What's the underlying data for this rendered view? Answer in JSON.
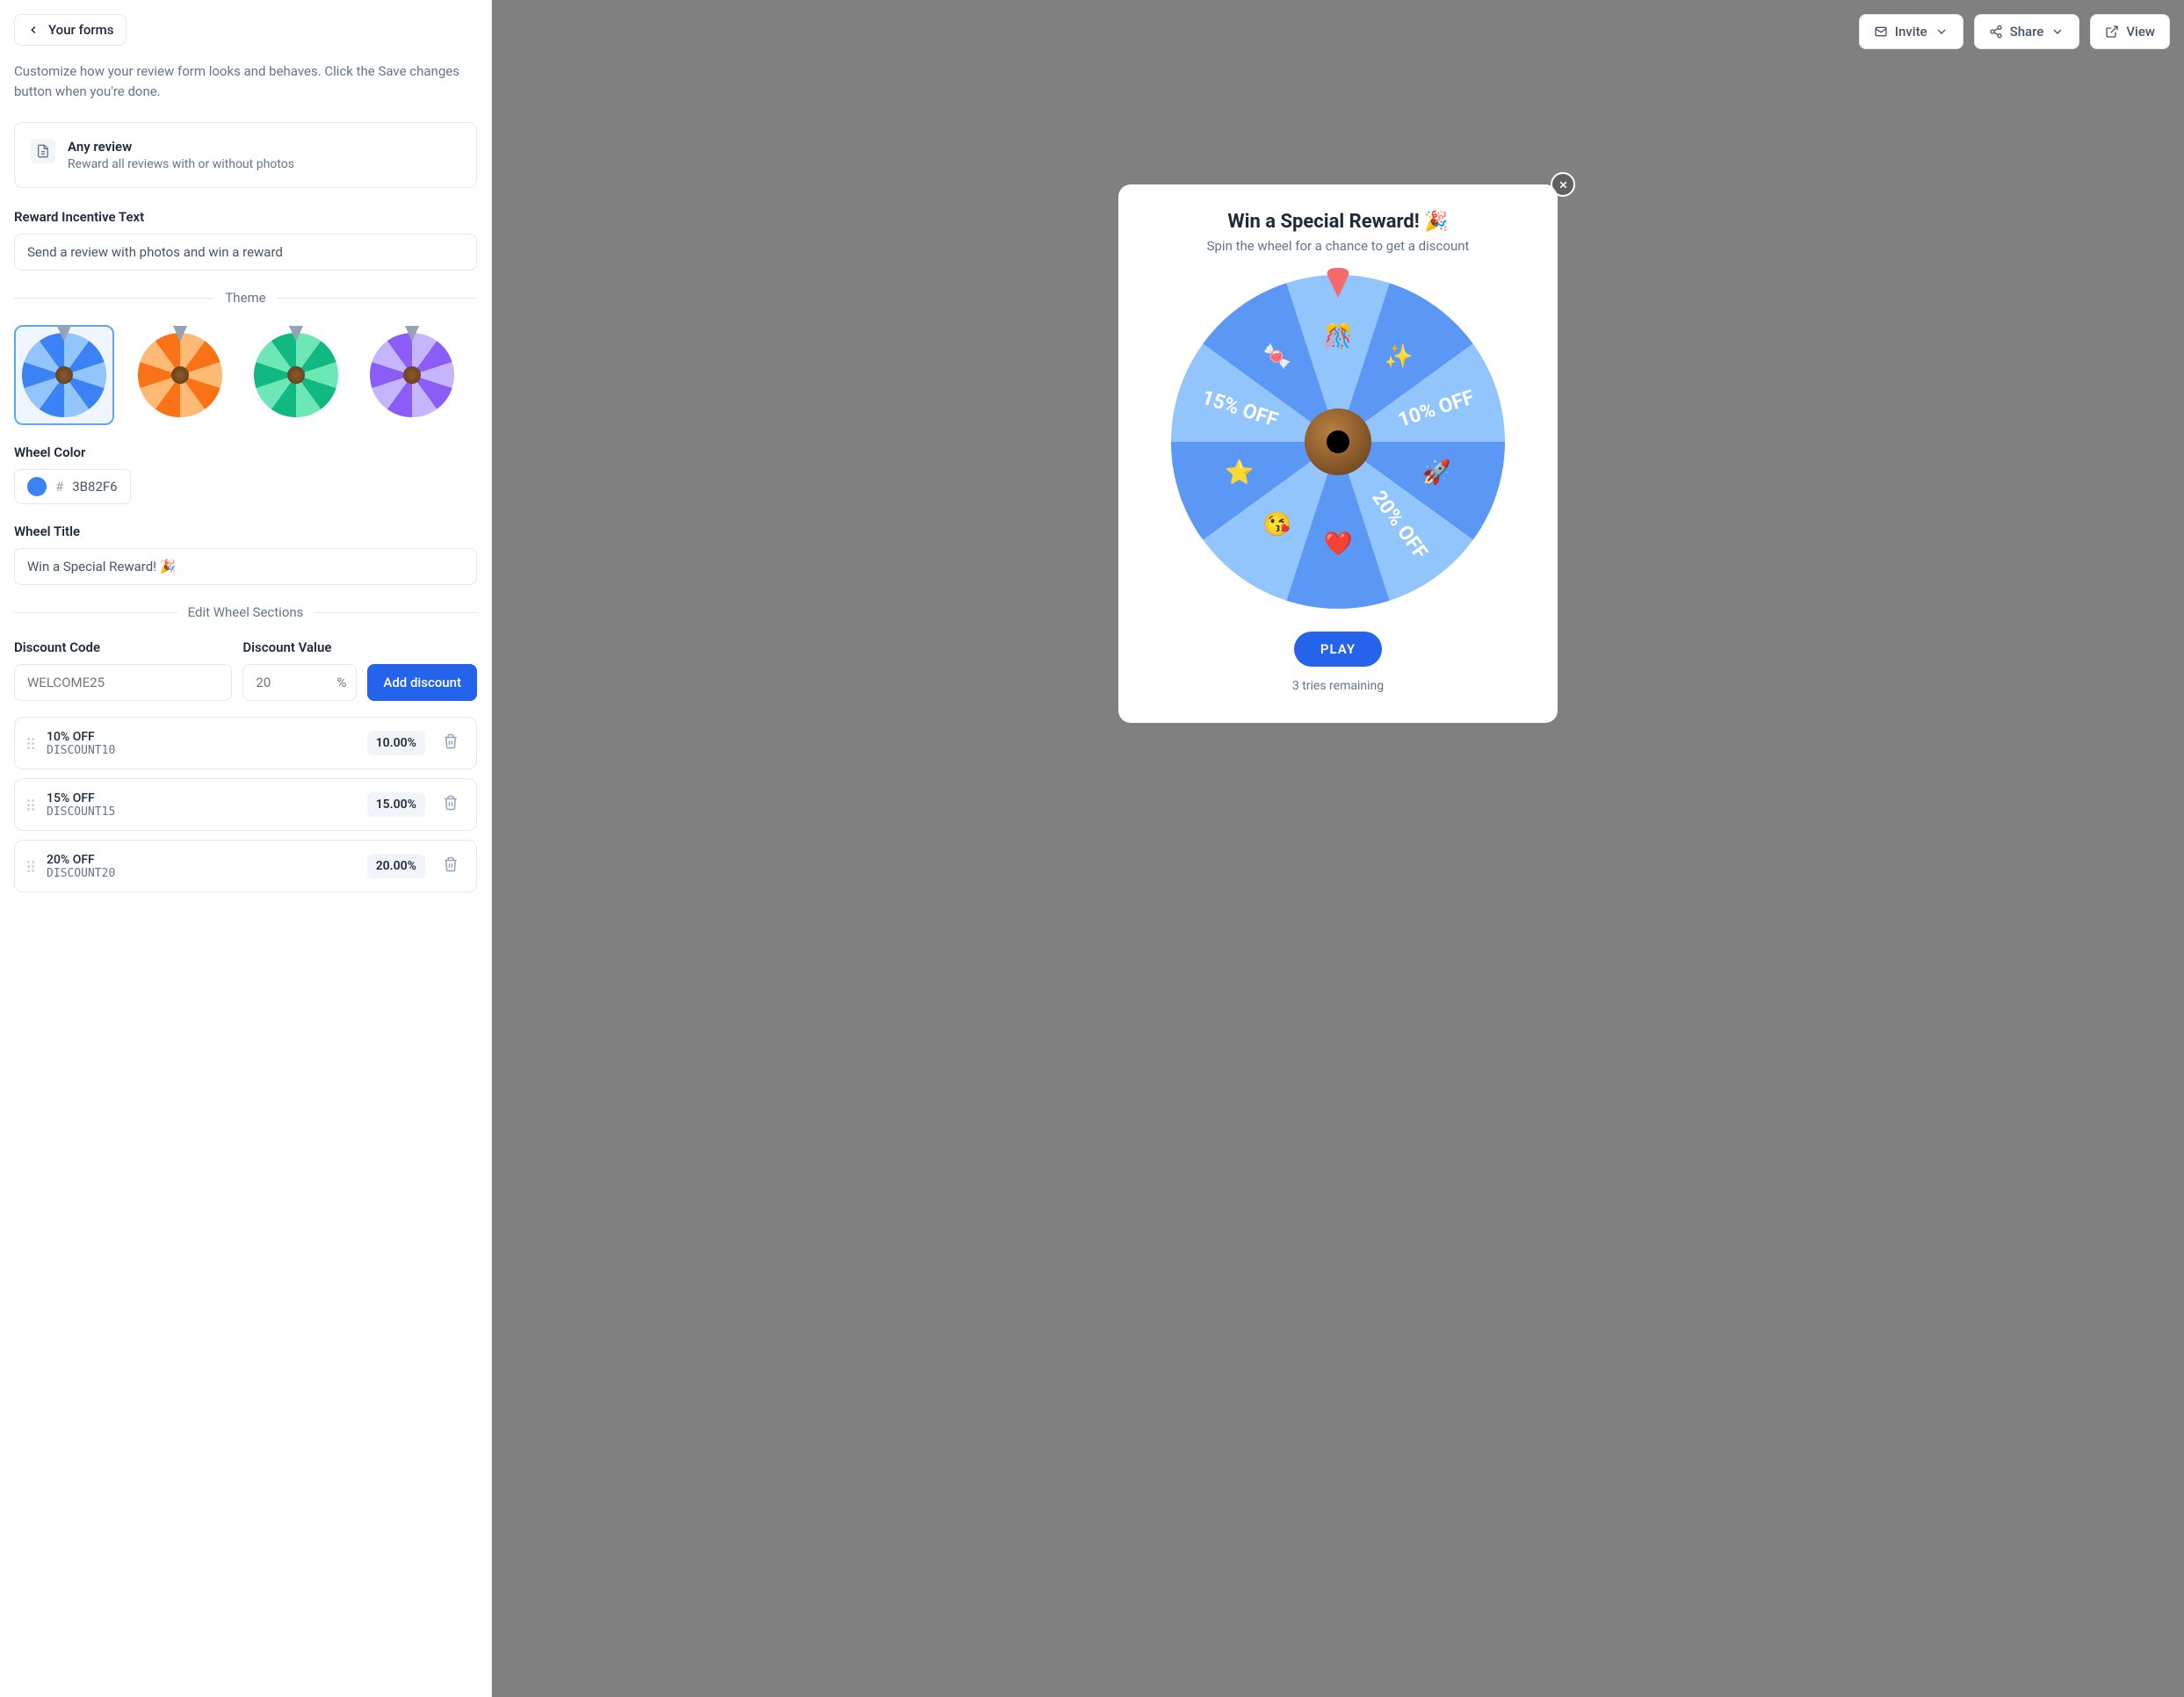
{
  "header": {
    "back_label": "Your forms",
    "invite_label": "Invite",
    "share_label": "Share",
    "view_label": "View"
  },
  "description": "Customize how your review form looks and behaves. Click the Save changes button when you're done.",
  "review_type": {
    "title": "Any review",
    "subtitle": "Reward all reviews with or without photos"
  },
  "incentive": {
    "label": "Reward Incentive Text",
    "value": "Send a review with photos and win a reward"
  },
  "theme": {
    "section_label": "Theme",
    "options": [
      {
        "id": "blue",
        "light": "#93c5fd",
        "dark": "#3b82f6",
        "selected": true
      },
      {
        "id": "orange",
        "light": "#fdba74",
        "dark": "#f97316",
        "selected": false
      },
      {
        "id": "green",
        "light": "#6ee7b7",
        "dark": "#10b981",
        "selected": false
      },
      {
        "id": "purple",
        "light": "#c4b5fd",
        "dark": "#8b5cf6",
        "selected": false
      }
    ]
  },
  "wheel_color": {
    "label": "Wheel Color",
    "hex": "3B82F6"
  },
  "wheel_title": {
    "label": "Wheel Title",
    "value": "Win a Special Reward! 🎉"
  },
  "sections_label": "Edit Wheel Sections",
  "discount_form": {
    "code_label": "Discount Code",
    "code_placeholder": "WELCOME25",
    "value_label": "Discount Value",
    "value_placeholder": "20",
    "percent": "%",
    "add_button": "Add discount"
  },
  "discounts": [
    {
      "name": "10% OFF",
      "code": "DISCOUNT10",
      "value": "10.00%"
    },
    {
      "name": "15% OFF",
      "code": "DISCOUNT15",
      "value": "15.00%"
    },
    {
      "name": "20% OFF",
      "code": "DISCOUNT20",
      "value": "20.00%"
    }
  ],
  "preview": {
    "title": "Win a Special Reward! 🎉",
    "subtitle": "Spin the wheel for a chance to get a discount",
    "play_label": "PLAY",
    "tries_text": "3 tries remaining",
    "segments": [
      {
        "label": "",
        "emoji": "🎊",
        "color": "#93c5fd"
      },
      {
        "label": "",
        "emoji": "✨",
        "color": "#5b97f5"
      },
      {
        "label": "10% OFF",
        "emoji": "",
        "color": "#93c5fd"
      },
      {
        "label": "",
        "emoji": "🚀",
        "color": "#5b97f5"
      },
      {
        "label": "20% OFF",
        "emoji": "",
        "color": "#93c5fd"
      },
      {
        "label": "",
        "emoji": "❤️",
        "color": "#5b97f5"
      },
      {
        "label": "",
        "emoji": "😘",
        "color": "#93c5fd"
      },
      {
        "label": "",
        "emoji": "⭐",
        "color": "#5b97f5"
      },
      {
        "label": "15% OFF",
        "emoji": "",
        "color": "#93c5fd"
      },
      {
        "label": "",
        "emoji": "🍬",
        "color": "#5b97f5"
      }
    ]
  }
}
